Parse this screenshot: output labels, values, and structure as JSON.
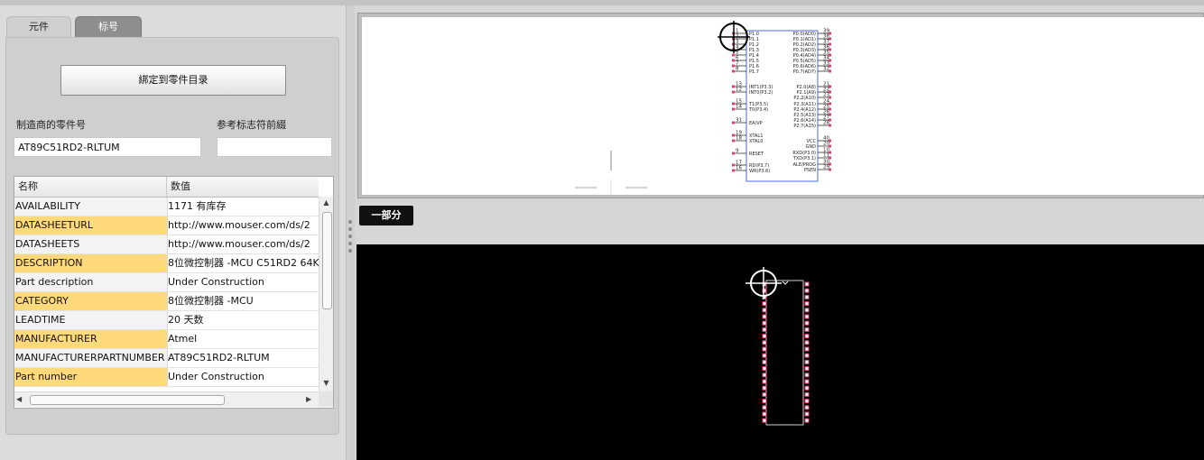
{
  "tabs": {
    "parts": "元件",
    "labels": "标号"
  },
  "bind_button": "綁定到零件目录",
  "manufacturer_part": {
    "label": "制造商的零件号",
    "value": "AT89C51RD2-RLTUM"
  },
  "reference_prefix": {
    "label": "参考标志符前綴",
    "value": ""
  },
  "grid": {
    "headers": {
      "name": "名称",
      "value": "数值"
    },
    "rows": [
      {
        "name": "AVAILABILITY",
        "value": "1171 有库存",
        "highlight": false
      },
      {
        "name": "DATASHEETURL",
        "value": "http://www.mouser.com/ds/2",
        "highlight": true
      },
      {
        "name": "DATASHEETS",
        "value": "http://www.mouser.com/ds/2",
        "highlight": false
      },
      {
        "name": "DESCRIPTION",
        "value": "8位微控制器 -MCU C51RD2 64K",
        "highlight": true
      },
      {
        "name": "Part description",
        "value": "Under Construction",
        "highlight": false
      },
      {
        "name": "CATEGORY",
        "value": "8位微控制器 -MCU",
        "highlight": true
      },
      {
        "name": "LEADTIME",
        "value": "20 天数",
        "highlight": false
      },
      {
        "name": "MANUFACTURER",
        "value": "Atmel",
        "highlight": true
      },
      {
        "name": "MANUFACTURERPARTNUMBER",
        "value": "AT89C51RD2-RLTUM",
        "highlight": false
      },
      {
        "name": "Part number",
        "value": "Under Construction",
        "highlight": true
      }
    ]
  },
  "preview": {
    "part_tag": "一部分"
  },
  "symbol": {
    "left_pins": [
      {
        "num": "1",
        "label": "P1.0"
      },
      {
        "num": "2",
        "label": "P1.1"
      },
      {
        "num": "3",
        "label": "P1.2"
      },
      {
        "num": "4",
        "label": "P1.3"
      },
      {
        "num": "5",
        "label": "P1.4"
      },
      {
        "num": "6",
        "label": "P1.5"
      },
      {
        "num": "7",
        "label": "P1.6"
      },
      {
        "num": "8",
        "label": "P1.7"
      },
      {
        "num": "13",
        "label": "INT1(P3.3)"
      },
      {
        "num": "12",
        "label": "INT0(P3.2)"
      },
      {
        "num": "15",
        "label": "T1(P3.5)"
      },
      {
        "num": "14",
        "label": "T0(P3.4)"
      },
      {
        "num": "31",
        "label": "EA/VP"
      },
      {
        "num": "19",
        "label": "XTAL1"
      },
      {
        "num": "18",
        "label": "XTAL0"
      },
      {
        "num": "9",
        "label": "RESET"
      },
      {
        "num": "17",
        "label": "RD(P3.7)"
      },
      {
        "num": "16",
        "label": "WR(P3.6)"
      }
    ],
    "right_pins": [
      {
        "num": "39",
        "label": "P0.0(AD0)"
      },
      {
        "num": "38",
        "label": "P0.1(AD1)"
      },
      {
        "num": "37",
        "label": "P0.2(AD2)"
      },
      {
        "num": "36",
        "label": "P0.3(AD3)"
      },
      {
        "num": "35",
        "label": "P0.4(AD4)"
      },
      {
        "num": "34",
        "label": "P0.5(AD5)"
      },
      {
        "num": "33",
        "label": "P0.6(AD6)"
      },
      {
        "num": "32",
        "label": "P0.7(AD7)"
      },
      {
        "num": "21",
        "label": "P2.0(A8)"
      },
      {
        "num": "22",
        "label": "P2.1(A9)"
      },
      {
        "num": "23",
        "label": "P2.2(A10)"
      },
      {
        "num": "24",
        "label": "P2.3(A11)"
      },
      {
        "num": "25",
        "label": "P2.4(A12)"
      },
      {
        "num": "26",
        "label": "P2.5(A13)"
      },
      {
        "num": "27",
        "label": "P2.6(A14)"
      },
      {
        "num": "28",
        "label": "P2.7(A15)"
      },
      {
        "num": "40",
        "label": "VCC"
      },
      {
        "num": "20",
        "label": "GND"
      },
      {
        "num": "10",
        "label": "RXD(P3.0)"
      },
      {
        "num": "11",
        "label": "TXD(P3.1)"
      },
      {
        "num": "30",
        "label": "ALE/PROG"
      },
      {
        "num": "29",
        "label": "PSEN"
      }
    ]
  },
  "colors": {
    "highlight_row": "#ffd97a",
    "pin_marker": "#e0407a",
    "symbol_outline": "#4a6adf"
  }
}
